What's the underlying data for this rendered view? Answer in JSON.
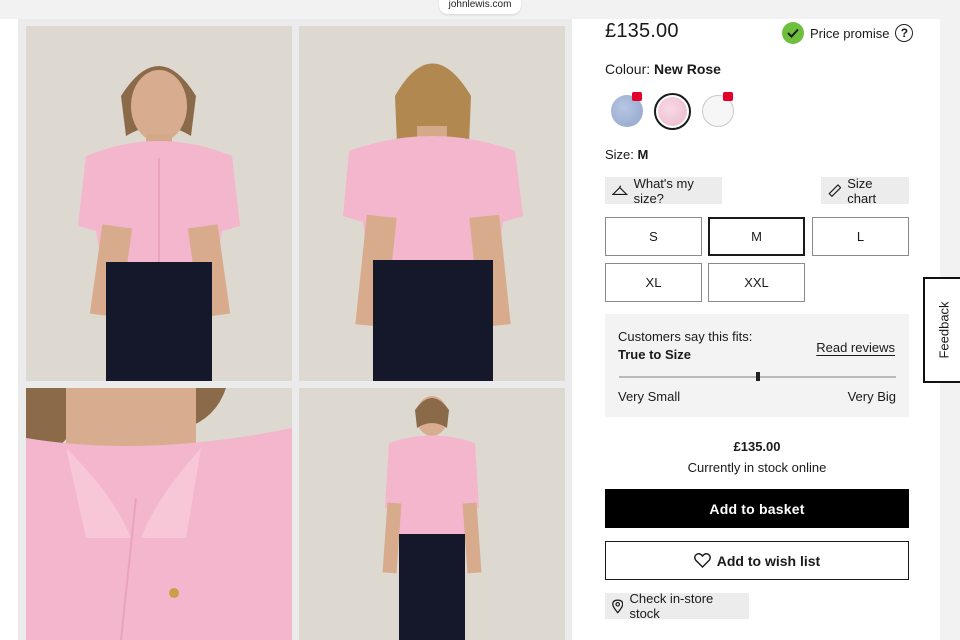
{
  "browser": {
    "url": "johnlewis.com"
  },
  "product": {
    "price": "£135.00",
    "price_promise_label": "Price promise",
    "colour_label": "Colour:",
    "colour_value": "New Rose",
    "swatches": [
      {
        "name": "Blue",
        "color": "#a4b4d8",
        "sale_tag": true
      },
      {
        "name": "New Rose",
        "color": "#f2c8da",
        "selected": true
      },
      {
        "name": "White",
        "color": "#f6f6f6",
        "sale_tag": true
      }
    ],
    "size_label": "Size:",
    "size_value": "M",
    "whats_my_size": "What's my size?",
    "size_chart": "Size chart",
    "sizes": [
      {
        "label": "S",
        "selected": false
      },
      {
        "label": "M",
        "selected": true
      },
      {
        "label": "L",
        "selected": false
      },
      {
        "label": "XL",
        "selected": false
      },
      {
        "label": "XXL",
        "selected": false
      }
    ]
  },
  "fit": {
    "title": "Customers say this fits:",
    "value": "True to Size",
    "read_reviews": "Read reviews",
    "scale_min": "Very Small",
    "scale_max": "Very Big",
    "position_fraction": 0.5
  },
  "summary": {
    "price": "£135.00",
    "stock": "Currently in stock online"
  },
  "actions": {
    "add_to_basket": "Add to basket",
    "add_to_wish_list": "Add to wish list",
    "check_store_stock": "Check in-store stock"
  },
  "feedback": {
    "label": "Feedback"
  },
  "colors": {
    "accent_green": "#6fbf3f",
    "sale_tag_red": "#e3002b",
    "primary_black": "#000000"
  }
}
